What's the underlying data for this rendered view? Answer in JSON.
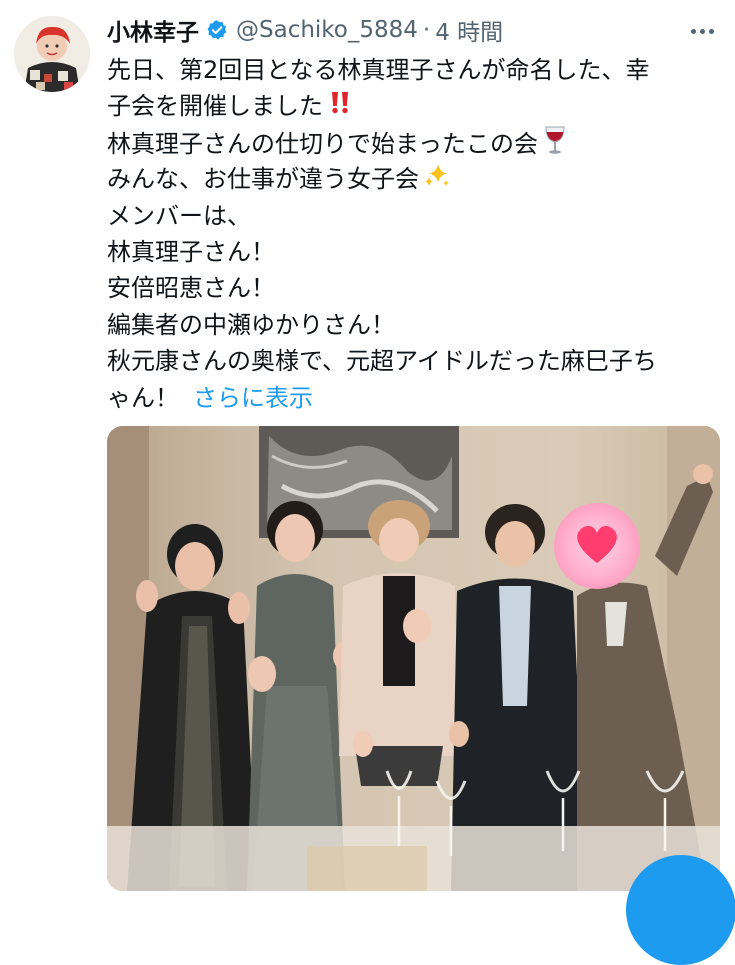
{
  "tweet": {
    "author_name": "小林幸子",
    "handle": "@Sachiko_5884",
    "separator": "·",
    "time": "4 時間",
    "lines": [
      "先日、第2回目となる林真理子さんが命名した、幸",
      "子会を開催しました",
      "林真理子さんの仕切りで始まったこの会",
      "みんな、お仕事が違う女子会",
      "メンバーは、",
      "林真理子さん！",
      "安倍昭恵さん！",
      "編集者の中瀬ゆかりさん！",
      "秋元康さんの奥様で、元超アイドルだった麻巳子ち",
      "ゃん！"
    ],
    "show_more": "さらに表示"
  },
  "icons": {
    "verified": "verified-badge-icon",
    "more": "more-options-icon",
    "exclamation": "double-exclamation-icon",
    "wine": "wine-glass-icon",
    "sparkles": "sparkles-icon",
    "heart": "heart-sticker-icon"
  },
  "colors": {
    "accent": "#1d9bf0",
    "text": "#0f1419",
    "secondary": "#536471"
  }
}
